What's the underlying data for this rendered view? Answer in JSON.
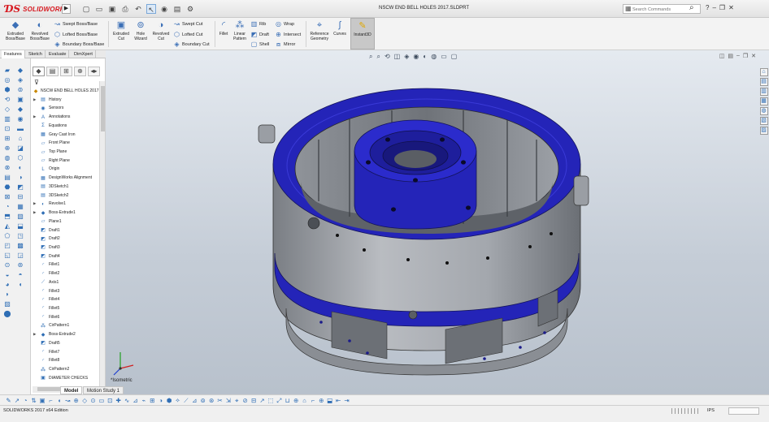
{
  "app": {
    "brand": "SOLIDWORKS",
    "document_title": "NSCW END BELL HOLES 2017.SLDPRT",
    "search_placeholder": "Search Commands"
  },
  "ribbon": {
    "extruded_boss": "Extruded\nBoss/Base",
    "revolved_boss": "Revolved\nBoss/Base",
    "swept_boss": "Swept Boss/Base",
    "lofted_boss": "Lofted Boss/Base",
    "boundary_boss": "Boundary Boss/Base",
    "extruded_cut": "Extruded\nCut",
    "hole_wizard": "Hole\nWizard",
    "revolved_cut": "Revolved\nCut",
    "swept_cut": "Swept Cut",
    "lofted_cut": "Lofted Cut",
    "boundary_cut": "Boundary Cut",
    "fillet": "Fillet",
    "linear_pattern": "Linear\nPattern",
    "rib": "Rib",
    "draft": "Draft",
    "shell": "Shell",
    "wrap": "Wrap",
    "intersect": "Intersect",
    "mirror": "Mirror",
    "reference_geometry": "Reference\nGeometry",
    "curves": "Curves",
    "instant3d": "Instant3D"
  },
  "cm_tabs": [
    "Features",
    "Sketch",
    "Evaluate",
    "DimXpert"
  ],
  "tree": {
    "root": "NSCW END BELL HOLES 2017 (",
    "items": [
      "History",
      "Sensors",
      "Annotations",
      "Equations",
      "Gray Cast Iron",
      "Front Plane",
      "Top Plane",
      "Right Plane",
      "Origin",
      "DesignWorks Alignment",
      "3DSketch1",
      "3DSketch2",
      "Revolve1",
      "Boss-Extrude1",
      "Plane1",
      "Draft1",
      "Draft2",
      "Draft3",
      "Draft4",
      "Fillet1",
      "Fillet2",
      "Axis1",
      "Fillet3",
      "Fillet4",
      "Fillet5",
      "Fillet6",
      "CirPattern1",
      "Boss-Extrude2",
      "Draft5",
      "Fillet7",
      "Fillet8",
      "CirPattern2",
      "DIAMETER CHECKS"
    ]
  },
  "viewport": {
    "view_label": "*Isometric",
    "colors": {
      "body": "#a9adb3",
      "accent": "#2424b8",
      "background": "#cdd4dd"
    }
  },
  "bottom_tabs": [
    "Model",
    "Motion Study 1"
  ],
  "status": {
    "text": "SOLIDWORKS 2017 x64 Edition",
    "units": "IPS"
  },
  "icons": {
    "search": "search-icon",
    "help": "help-icon",
    "minimize": "minimize-icon",
    "restore": "restore-icon",
    "close": "close-icon"
  }
}
